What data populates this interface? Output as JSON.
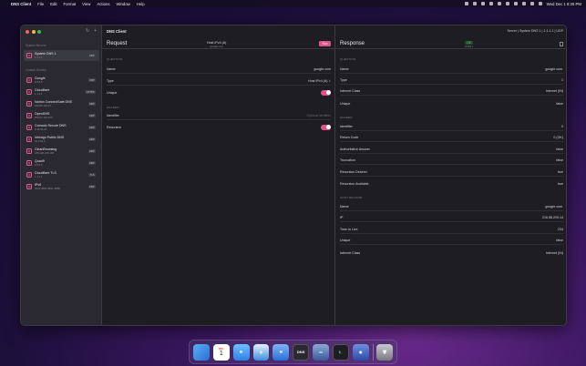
{
  "menubar": {
    "apple": "",
    "app": "DNS Client",
    "items": [
      "File",
      "Edit",
      "Format",
      "View",
      "Actions",
      "Window",
      "Help"
    ],
    "clock": "Wed Dec 1  8:26 PM"
  },
  "window": {
    "title": "DNS Client",
    "server_label": "Server | System DNS 1 | 1.1.1.1 | UDP"
  },
  "sidebar": {
    "system_title": "System Servers",
    "custom_title": "Custom Servers",
    "system_items": [
      {
        "name": "System DNS 1",
        "address": "1.1.1.1",
        "protocol": "UDP",
        "selected": true
      }
    ],
    "custom_items": [
      {
        "name": "Google",
        "address": "8.8.8.8",
        "protocol": "UDP"
      },
      {
        "name": "Cloudflare",
        "address": "1.1.1.1",
        "protocol": "HTTPS"
      },
      {
        "name": "Norton ConnectSafe DNS",
        "address": "199.85.126.10",
        "protocol": "UDP"
      },
      {
        "name": "OpenDNS",
        "address": "208.67.222.220",
        "protocol": "UDP"
      },
      {
        "name": "Comodo Secure DNS",
        "address": "8.26.56.26",
        "protocol": "UDP"
      },
      {
        "name": "Verisign Public DNS",
        "address": "64.6.64.6",
        "protocol": "UDP"
      },
      {
        "name": "CleanBrowsing",
        "address": "185.228.168.168",
        "protocol": "UDP"
      },
      {
        "name": "Quad9",
        "address": "9.9.9.9",
        "protocol": "UDP"
      },
      {
        "name": "Cloudflare TLS",
        "address": "1.1.1.1",
        "protocol": "TLS"
      },
      {
        "name": "IPv6",
        "address": "2001:4860:4860::8888",
        "protocol": "UDP"
      }
    ]
  },
  "request": {
    "title": "Request",
    "summary_type": "Host IPv4 (A)",
    "summary_name": "google.com",
    "run_label": "Run",
    "question_label": "QUESTION",
    "name_label": "Name",
    "name_value": "google.com",
    "type_label": "Type",
    "type_value": "Host IPv4 (A)",
    "unique_label": "Unique",
    "header_label": "HEADER",
    "identifier_label": "Identifier",
    "identifier_placeholder": "Optional Identifier",
    "recursive_label": "Recursive"
  },
  "response": {
    "title": "Response",
    "status_code": "OK",
    "elapsed": "0.003 s",
    "question_label": "QUESTION",
    "q_rows": [
      {
        "label": "Name",
        "value": "google.com."
      },
      {
        "label": "Type",
        "value": "1"
      },
      {
        "label": "Internet Class",
        "value": "Internet (IN)"
      },
      {
        "label": "Unique",
        "value": "false"
      }
    ],
    "header_label": "HEADER",
    "h_rows": [
      {
        "label": "Identifier",
        "value": "0"
      },
      {
        "label": "Return Code",
        "value": "0 (OK)"
      },
      {
        "label": "Authoritative Answer",
        "value": "false"
      },
      {
        "label": "Truncation",
        "value": "false"
      },
      {
        "label": "Recursion Desired",
        "value": "true"
      },
      {
        "label": "Recursion Available",
        "value": "true"
      }
    ],
    "host_label": "HOST RECORD",
    "r_rows": [
      {
        "label": "Name",
        "value": "google.com."
      },
      {
        "label": "IP",
        "value": "216.58.209.14"
      },
      {
        "label": "Time to Live",
        "value": "234"
      },
      {
        "label": "Unique",
        "value": "false"
      },
      {
        "label": "Internet Class",
        "value": "Internet (IN)"
      }
    ]
  },
  "dock": {
    "items": [
      {
        "name": "finder",
        "label": "",
        "color": "#3a8ee6"
      },
      {
        "name": "calendar",
        "label": "1",
        "color": "#ffffff"
      },
      {
        "name": "mail",
        "label": "",
        "color": "#4aa3f0"
      },
      {
        "name": "safari",
        "label": "",
        "color": "#3b8fe0"
      },
      {
        "name": "xcode",
        "label": "",
        "color": "#2d6fd8"
      },
      {
        "name": "dns-client",
        "label": "DNS",
        "color": "#2a2a30"
      },
      {
        "name": "simulator",
        "label": "",
        "color": "#4a6ea8"
      },
      {
        "name": "terminal",
        "label": "$_",
        "color": "#222226"
      },
      {
        "name": "instruments",
        "label": "",
        "color": "#3a5ab0"
      },
      {
        "name": "trash",
        "label": "",
        "color": "#8a8a92"
      }
    ]
  }
}
